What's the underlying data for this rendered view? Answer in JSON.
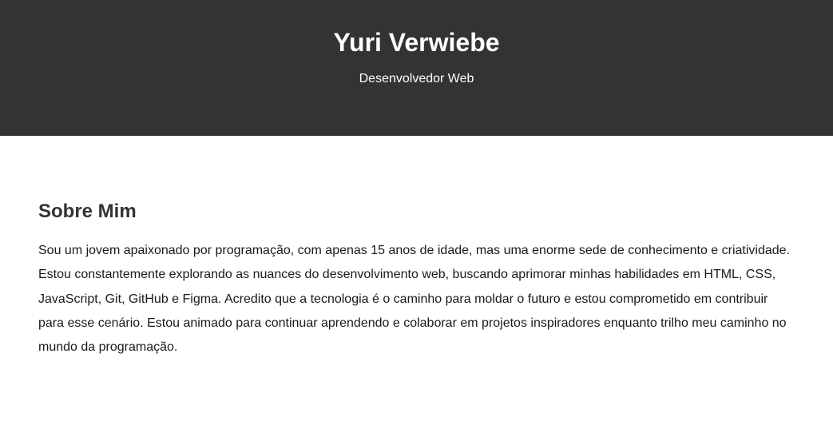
{
  "header": {
    "title": "Yuri Verwiebe",
    "subtitle": "Desenvolvedor Web"
  },
  "about": {
    "heading": "Sobre Mim",
    "text": "Sou um jovem apaixonado por programação, com apenas 15 anos de idade, mas uma enorme sede de conhecimento e criatividade. Estou constantemente explorando as nuances do desenvolvimento web, buscando aprimorar minhas habilidades em HTML, CSS, JavaScript, Git, GitHub e Figma. Acredito que a tecnologia é o caminho para moldar o futuro e estou comprometido em contribuir para esse cenário. Estou animado para continuar aprendendo e colaborar em projetos inspiradores enquanto trilho meu caminho no mundo da programação."
  },
  "colors": {
    "header_background": "#333333",
    "header_text": "#ffffff",
    "page_background": "#ffffff",
    "body_text": "#333333"
  }
}
